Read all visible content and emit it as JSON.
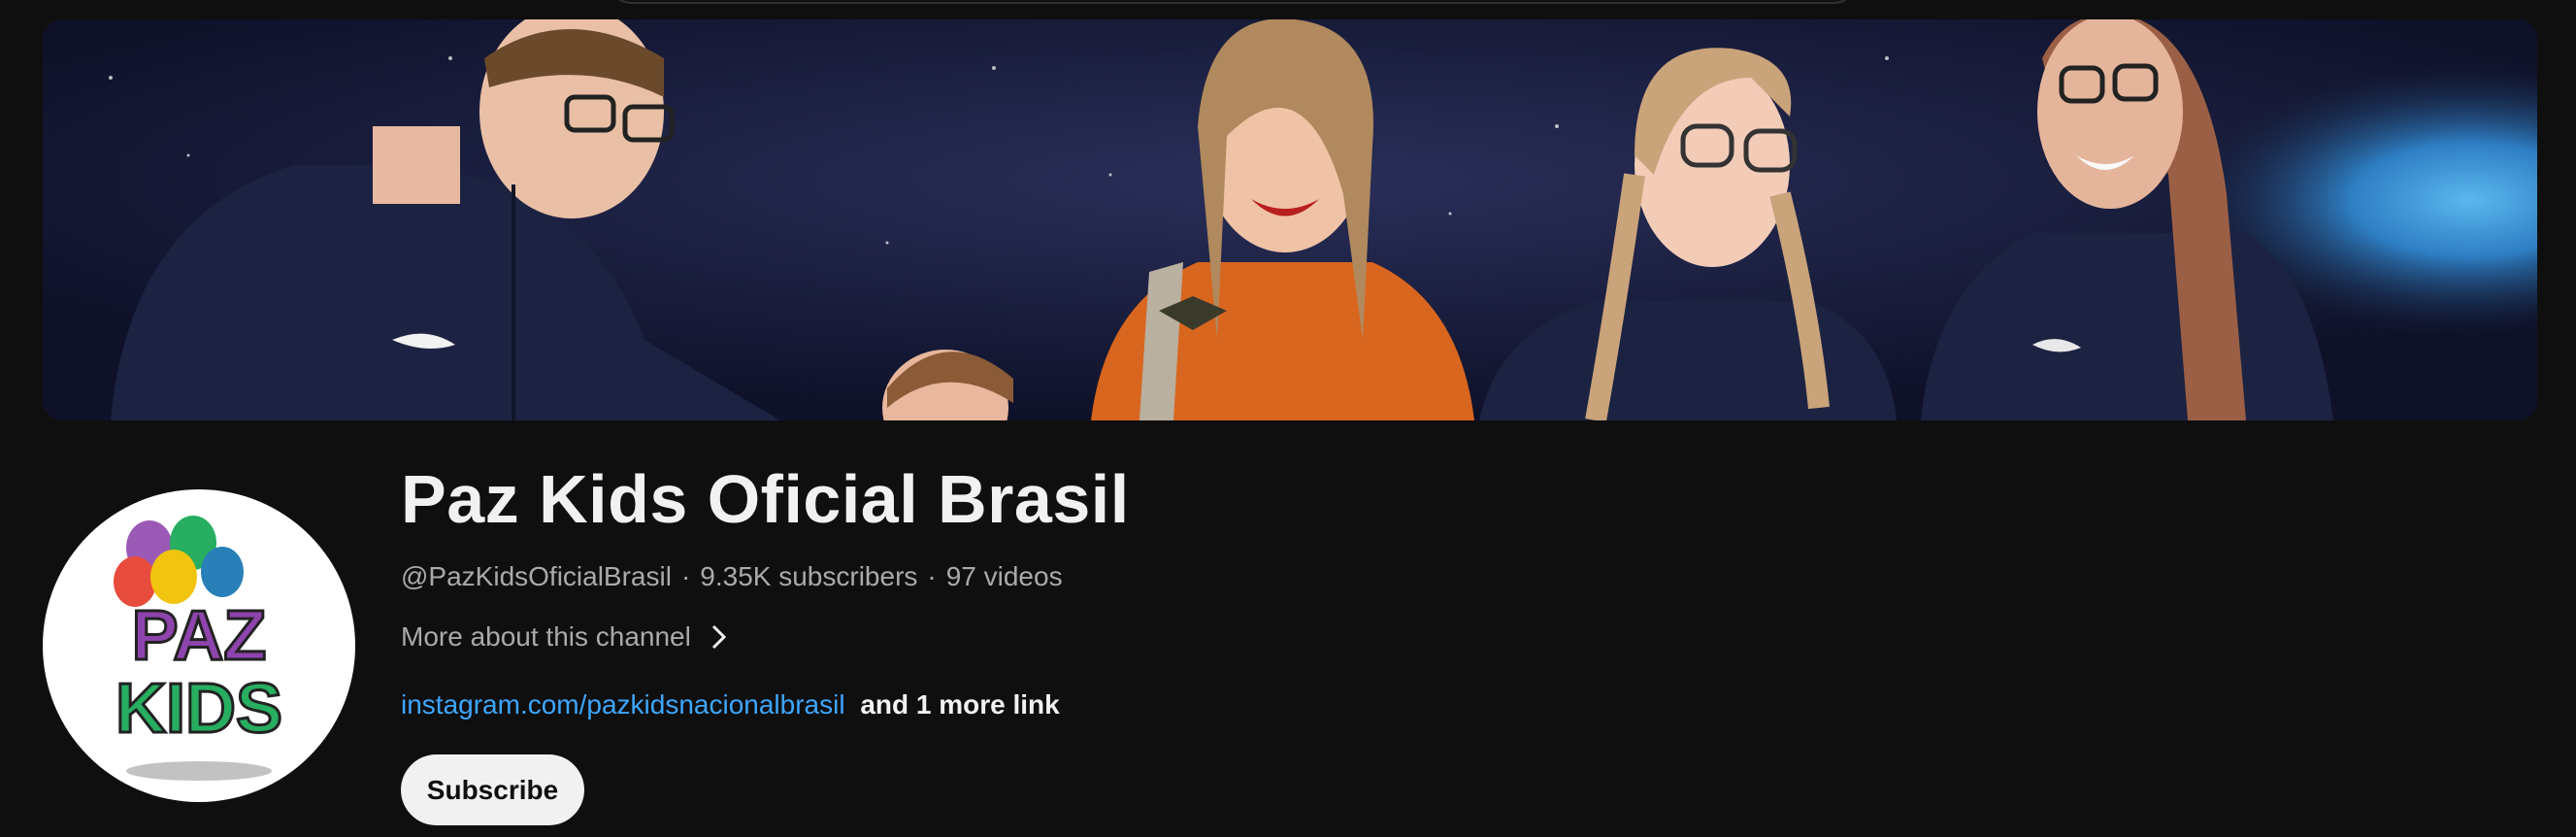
{
  "channel": {
    "name": "Paz Kids Oficial Brasil",
    "handle": "@PazKidsOficialBrasil",
    "subscribers": "9.35K subscribers",
    "videos": "97 videos",
    "separator": "·",
    "more_about_label": "More about this channel",
    "link_url_text": "instagram.com/pazkidsnacionalbrasil",
    "link_more_text": "and 1 more link",
    "subscribe_label": "Subscribe"
  },
  "avatar": {
    "logo_text_line1": "PAZ",
    "logo_text_line2": "KIDS"
  },
  "colors": {
    "background": "#0f0f0f",
    "title": "#f1f1f1",
    "meta": "#aaaaaa",
    "link": "#3ea6ff",
    "subscribe_bg": "#f1f1f1",
    "subscribe_text": "#0f0f0f",
    "banner_space": "#131833",
    "banner_nebula": "#2e7fc4",
    "flight_suit_navy": "#1c2342",
    "flight_suit_orange": "#d9661f"
  },
  "icons": {
    "more_about": "chevron-right-icon"
  }
}
